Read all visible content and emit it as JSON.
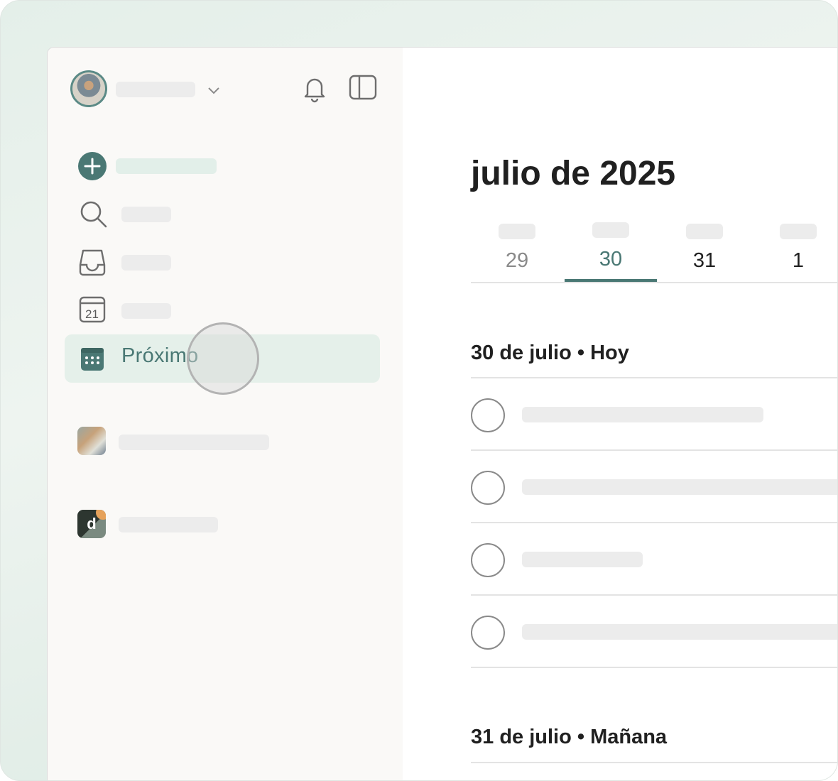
{
  "sidebar": {
    "selected_item_label": "Próximo",
    "calendar_icon_day": "21",
    "workspace_logo_letter": "d"
  },
  "main": {
    "month_title": "julio de 2025",
    "days": [
      {
        "num": "29",
        "state": "past"
      },
      {
        "num": "30",
        "state": "active"
      },
      {
        "num": "31",
        "state": "future"
      },
      {
        "num": "1",
        "state": "future"
      }
    ],
    "sections": [
      {
        "title": "30 de julio • Hoy",
        "task_count": 4
      },
      {
        "title": "31 de julio • Mañana",
        "task_count": 0
      }
    ]
  },
  "colors": {
    "accent": "#4a7874",
    "accent_bg": "#e5f0ea",
    "sidebar_bg": "#faf9f7",
    "placeholder": "#ececec"
  },
  "icons": [
    "chevron-down-icon",
    "bell-icon",
    "sidebar-toggle-icon",
    "add-task-icon",
    "search-icon",
    "inbox-icon",
    "today-calendar-icon",
    "upcoming-calendar-icon"
  ]
}
